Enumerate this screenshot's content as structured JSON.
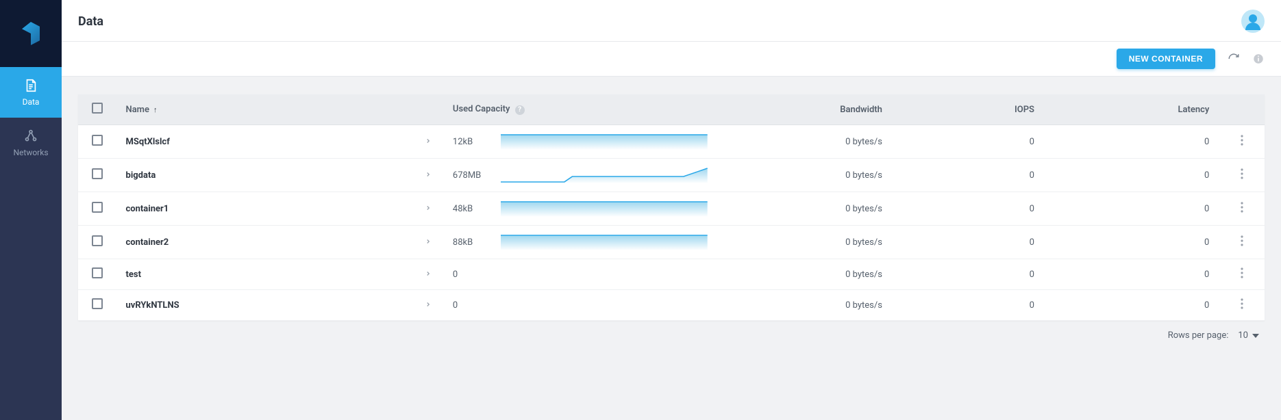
{
  "sidebar": {
    "items": [
      {
        "key": "data",
        "label": "Data",
        "active": true
      },
      {
        "key": "networks",
        "label": "Networks",
        "active": false
      }
    ]
  },
  "header": {
    "title": "Data"
  },
  "toolbar": {
    "new_container_label": "NEW CONTAINER"
  },
  "table": {
    "columns": {
      "name": "Name",
      "used_capacity": "Used Capacity",
      "bandwidth": "Bandwidth",
      "iops": "IOPS",
      "latency": "Latency"
    },
    "sort": {
      "column": "name",
      "direction": "asc"
    },
    "rows": [
      {
        "name": "MSqtXlslcf",
        "used_capacity": "12kB",
        "spark": "flat",
        "bandwidth": "0 bytes/s",
        "iops": "0",
        "latency": "0"
      },
      {
        "name": "bigdata",
        "used_capacity": "678MB",
        "spark": "step",
        "bandwidth": "0 bytes/s",
        "iops": "0",
        "latency": "0"
      },
      {
        "name": "container1",
        "used_capacity": "48kB",
        "spark": "flat",
        "bandwidth": "0 bytes/s",
        "iops": "0",
        "latency": "0"
      },
      {
        "name": "container2",
        "used_capacity": "88kB",
        "spark": "flat",
        "bandwidth": "0 bytes/s",
        "iops": "0",
        "latency": "0"
      },
      {
        "name": "test",
        "used_capacity": "0",
        "spark": "none",
        "bandwidth": "0 bytes/s",
        "iops": "0",
        "latency": "0"
      },
      {
        "name": "uvRYkNTLNS",
        "used_capacity": "0",
        "spark": "none",
        "bandwidth": "0 bytes/s",
        "iops": "0",
        "latency": "0"
      }
    ]
  },
  "pagination": {
    "rows_per_page_label": "Rows per page:",
    "page_size": "10"
  },
  "colors": {
    "accent": "#2aa8e8",
    "sidebar_bg": "#2c3553",
    "logo_bg": "#0e1a33"
  }
}
